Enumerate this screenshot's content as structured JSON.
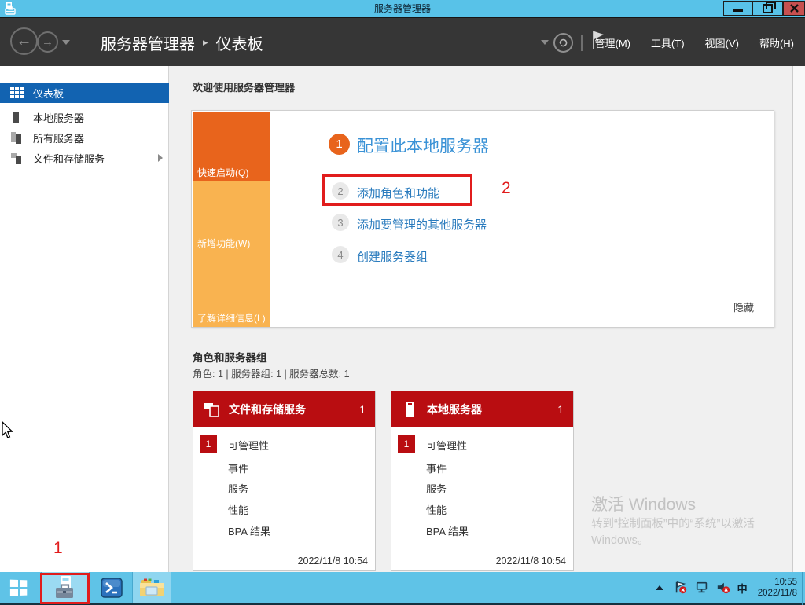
{
  "window": {
    "title": "服务器管理器"
  },
  "nav": {
    "breadcrumb": {
      "root": "服务器管理器",
      "separator": "▸",
      "current": "仪表板"
    },
    "menus": [
      {
        "label": "管理(M)"
      },
      {
        "label": "工具(T)"
      },
      {
        "label": "视图(V)"
      },
      {
        "label": "帮助(H)"
      }
    ]
  },
  "sidebar": {
    "items": [
      {
        "label": "仪表板"
      },
      {
        "label": "本地服务器"
      },
      {
        "label": "所有服务器"
      },
      {
        "label": "文件和存储服务"
      }
    ]
  },
  "main": {
    "welcome_header": "欢迎使用服务器管理器",
    "quickstart": {
      "sections": [
        {
          "label": "快速启动(Q)"
        },
        {
          "label": "新增功能(W)"
        },
        {
          "label": "了解详细信息(L)"
        }
      ],
      "steps": [
        {
          "num": "1",
          "label": "配置此本地服务器"
        },
        {
          "num": "2",
          "label": "添加角色和功能"
        },
        {
          "num": "3",
          "label": "添加要管理的其他服务器"
        },
        {
          "num": "4",
          "label": "创建服务器组"
        }
      ],
      "hide_label": "隐藏"
    },
    "roles": {
      "title": "角色和服务器组",
      "subtitle": "角色: 1 | 服务器组: 1 | 服务器总数: 1",
      "tiles": [
        {
          "title": "文件和存储服务",
          "count": "1",
          "badge": "1",
          "rows": [
            {
              "label": "可管理性"
            },
            {
              "label": "事件"
            },
            {
              "label": "服务"
            },
            {
              "label": "性能"
            },
            {
              "label": "BPA 结果"
            }
          ],
          "timestamp": "2022/11/8 10:54"
        },
        {
          "title": "本地服务器",
          "count": "1",
          "badge": "1",
          "rows": [
            {
              "label": "可管理性"
            },
            {
              "label": "事件"
            },
            {
              "label": "服务"
            },
            {
              "label": "性能"
            },
            {
              "label": "BPA 结果"
            }
          ],
          "timestamp": "2022/11/8 10:54"
        }
      ]
    },
    "activation": {
      "line1": "激活 Windows",
      "line2": "转到“控制面板”中的“系统”以激活",
      "line3": "Windows。"
    }
  },
  "annotations": {
    "step_box_number": "2",
    "taskbar_number": "1"
  },
  "taskbar": {
    "tray": {
      "ime": "中",
      "time": "10:55",
      "date": "2022/11/8"
    }
  },
  "colors": {
    "titlebar_blue": "#58c2e8",
    "taskbar_blue": "#5fc3e7",
    "selected_blue": "#1263b1",
    "link_blue": "#2b7cbe",
    "accent_orange": "#e8641c",
    "light_orange": "#f9b350",
    "tile_red": "#b90d11",
    "annotation_red": "#e11c1c"
  }
}
